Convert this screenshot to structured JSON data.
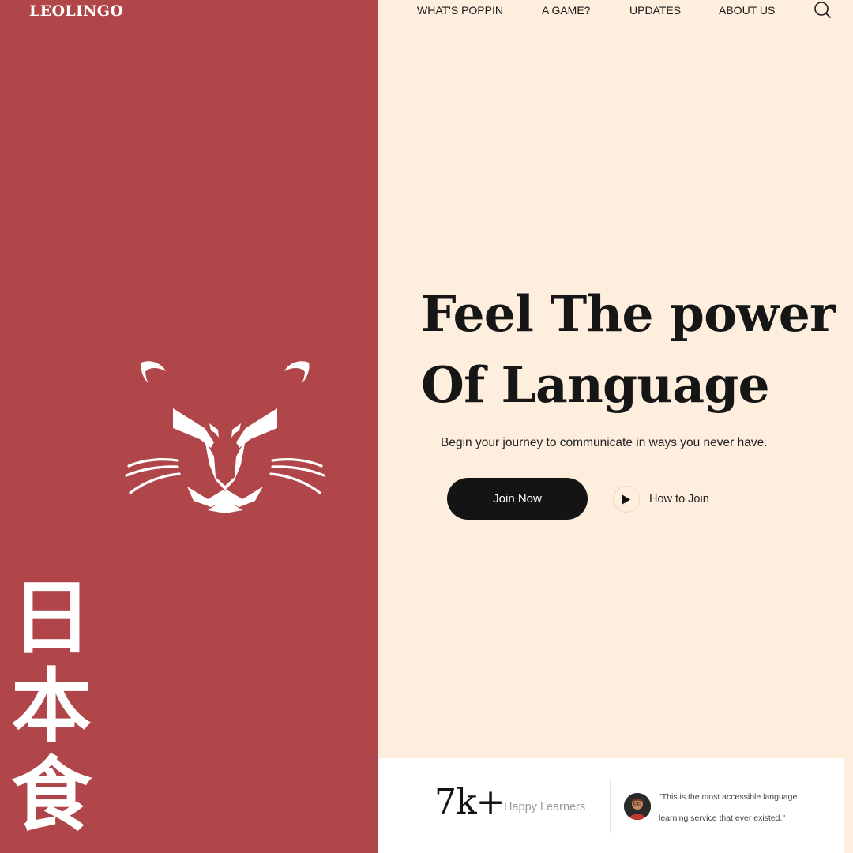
{
  "brand": {
    "name": "LEOLINGO"
  },
  "nav": {
    "items": [
      {
        "label": "WHAT'S POPPIN"
      },
      {
        "label": "A GAME?"
      },
      {
        "label": "UPDATES"
      },
      {
        "label": "ABOUT US"
      }
    ],
    "search_icon": "search-icon"
  },
  "side": {
    "mascot_icon": "lion-face-icon",
    "kanji": [
      "日",
      "本",
      "食"
    ]
  },
  "hero": {
    "headline_line1": "Feel The power",
    "headline_line2": "Of Language",
    "subheadline": "Begin your journey to communicate in ways you never have.",
    "join_label": "Join Now",
    "howto_label": "How to Join",
    "play_icon": "play-icon"
  },
  "stats": {
    "number": "7k+",
    "label": "Happy Learners",
    "quote": "\"This is the most accessible language learning service that ever existed.\"",
    "avatar_icon": "avatar"
  },
  "colors": {
    "left_panel": "#b0464a",
    "right_panel": "#fdeedd",
    "button": "#141414",
    "card": "#ffffff"
  }
}
